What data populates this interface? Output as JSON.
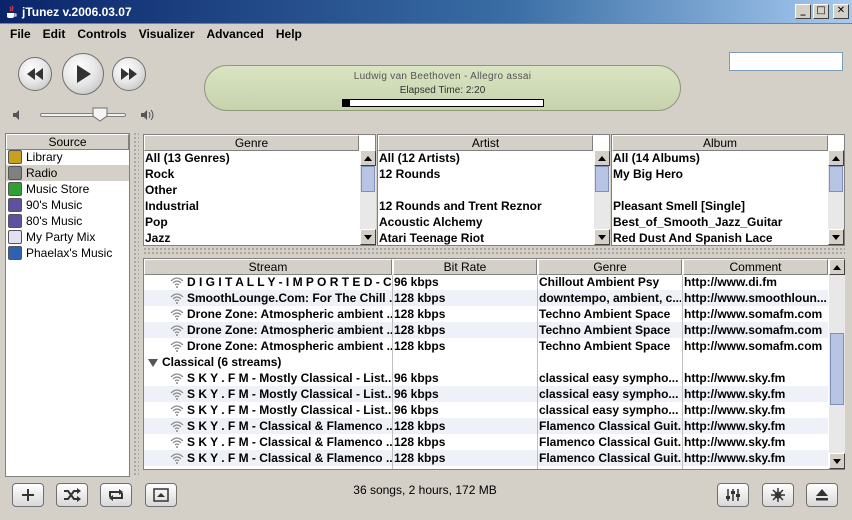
{
  "window": {
    "title": "jTunez v.2006.03.07"
  },
  "menu": [
    "File",
    "Edit",
    "Controls",
    "Visualizer",
    "Advanced",
    "Help"
  ],
  "player": {
    "now_playing": "Ludwig van Beethoven - Allegro assai",
    "elapsed": "Elapsed Time: 2:20",
    "progress": 0.035,
    "volume": 0.72,
    "search": {
      "value": ""
    }
  },
  "source": {
    "header": "Source",
    "items": [
      {
        "label": "Library",
        "icon": "library-icon",
        "color": "#c8a020"
      },
      {
        "label": "Radio",
        "icon": "radio-icon",
        "color": "#808080",
        "selected": true
      },
      {
        "label": "Music Store",
        "icon": "music-store-icon",
        "color": "#30a030"
      },
      {
        "label": "90's Music",
        "icon": "smart-playlist-icon",
        "color": "#6050a0"
      },
      {
        "label": "80's Music",
        "icon": "smart-playlist-icon",
        "color": "#6050a0"
      },
      {
        "label": "My Party Mix",
        "icon": "playlist-icon",
        "color": "#e0e0f0"
      },
      {
        "label": "Phaelax's Music",
        "icon": "playlist-icon",
        "color": "#3060b0"
      }
    ]
  },
  "browser": {
    "genre": {
      "header": "Genre",
      "items": [
        "All (13 Genres)",
        "Rock",
        "Other",
        "Industrial",
        "Pop",
        "Jazz"
      ]
    },
    "artist": {
      "header": "Artist",
      "items": [
        "All (12 Artists)",
        "12 Rounds",
        "",
        "12 Rounds and Trent Reznor",
        "Acoustic Alchemy",
        "Atari Teenage Riot"
      ]
    },
    "album": {
      "header": "Album",
      "items": [
        "All (14 Albums)",
        "My Big Hero",
        "",
        "Pleasant Smell [Single]",
        "Best_of_Smooth_Jazz_Guitar",
        "Red Dust And Spanish Lace"
      ]
    }
  },
  "streams": {
    "headers": {
      "stream": "Stream",
      "bitrate": "Bit Rate",
      "genre": "Genre",
      "comment": "Comment"
    },
    "rows_top": [
      {
        "stream": "D I G I T A L L Y - I M P O R T E D - C...",
        "bitrate": "96 kbps",
        "genre": "Chillout Ambient Psy",
        "comment": "http://www.di.fm"
      },
      {
        "stream": "SmoothLounge.Com: For The Chill ...",
        "bitrate": "128 kbps",
        "genre": "downtempo, ambient, c...",
        "comment": "http://www.smoothloun..."
      },
      {
        "stream": "Drone Zone: Atmospheric ambient ...",
        "bitrate": "128 kbps",
        "genre": "Techno Ambient Space",
        "comment": "http://www.somafm.com"
      },
      {
        "stream": "Drone Zone: Atmospheric ambient ...",
        "bitrate": "128 kbps",
        "genre": "Techno Ambient Space",
        "comment": "http://www.somafm.com"
      },
      {
        "stream": "Drone Zone: Atmospheric ambient ...",
        "bitrate": "128 kbps",
        "genre": "Techno Ambient Space",
        "comment": "http://www.somafm.com"
      }
    ],
    "group": "Classical (6 streams)",
    "rows_bottom": [
      {
        "stream": "S K Y . F M - Mostly Classical - List...",
        "bitrate": "96 kbps",
        "genre": "classical easy sympho...",
        "comment": "http://www.sky.fm"
      },
      {
        "stream": "S K Y . F M - Mostly Classical - List...",
        "bitrate": "96 kbps",
        "genre": "classical easy sympho...",
        "comment": "http://www.sky.fm"
      },
      {
        "stream": "S K Y . F M - Mostly Classical - List...",
        "bitrate": "96 kbps",
        "genre": "classical easy sympho...",
        "comment": "http://www.sky.fm"
      },
      {
        "stream": "S K Y . F M - Classical & Flamenco ...",
        "bitrate": "128 kbps",
        "genre": "Flamenco Classical Guit...",
        "comment": "http://www.sky.fm"
      },
      {
        "stream": "S K Y . F M - Classical & Flamenco ...",
        "bitrate": "128 kbps",
        "genre": "Flamenco Classical Guit...",
        "comment": "http://www.sky.fm"
      },
      {
        "stream": "S K Y . F M - Classical & Flamenco ...",
        "bitrate": "128 kbps",
        "genre": "Flamenco Classical Guit...",
        "comment": "http://www.sky.fm"
      }
    ]
  },
  "status": "36 songs, 2 hours, 172 MB",
  "colors": {
    "titlebar": "#0a246a",
    "display": "#d2ddb9",
    "scroll_thumb": "#b8c4e4"
  }
}
